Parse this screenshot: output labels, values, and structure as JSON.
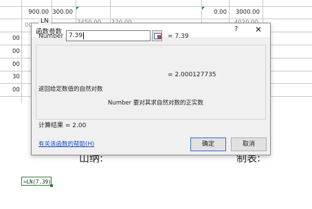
{
  "sheet": {
    "row1": [
      "900.00",
      "300.00",
      "0.00",
      "3000.00"
    ],
    "partial_values": [
      "00",
      "00",
      "00",
      "30",
      "00"
    ],
    "faded_values": [
      "2450.00",
      "220.00",
      "4020.00"
    ],
    "footer_left": "山纳:",
    "footer_right": "制表:",
    "formula": "=LN(7.39)"
  },
  "dialog": {
    "title": "函数参数",
    "help": "?",
    "close": "✕",
    "function_name": "LN",
    "arg_label": "Number",
    "arg_value": "7.39",
    "arg_eval": "= 7.39",
    "formula_result": "= 2.000127735",
    "description": "返回给定数值的自然对数",
    "arg_description": "Number  要对其求自然对数的正实数",
    "calc_result": "计算结果 =   2.00",
    "help_link": "有关该函数的帮助(H)",
    "ok_label": "确定",
    "cancel_label": "取消"
  }
}
